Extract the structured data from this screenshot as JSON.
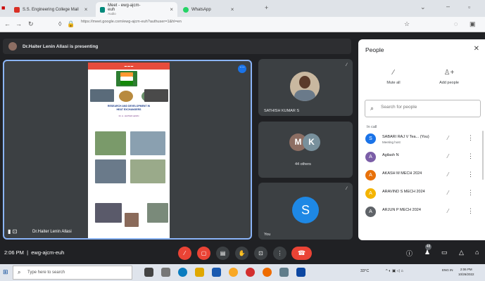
{
  "browser": {
    "tabs": [
      {
        "label": "S.S. Engineering College Mail",
        "icon": "gmail-icon",
        "color": "#d93025"
      },
      {
        "label": "Meet - ewg-ajcm-euh",
        "sublabel": "Audio",
        "icon": "meet-icon",
        "color": "#00897b"
      },
      {
        "label": "WhatsApp",
        "icon": "whatsapp-icon",
        "color": "#25d366"
      }
    ],
    "url": "https://meet.google.com/ewg-ajcm-euh?authuser=1&hl=en"
  },
  "meet": {
    "presenting_text": "Dr.Haiter Lenin Allasi is presenting",
    "main_tile": {
      "presenter_name": "Dr.Haiter Lenin Allasi",
      "slide": {
        "title_line1": "RESEARCH AND DEVELOPMENT IN",
        "title_line2": "HEAT EXCHANGERS",
        "author": "Dr. A. HAITER LENIN"
      }
    },
    "side_tiles": [
      {
        "name": "SATHISH KUMAR S"
      },
      {
        "name": "44 others",
        "initials": [
          "M",
          "K"
        ]
      },
      {
        "name": "You",
        "initial": "S"
      }
    ]
  },
  "people": {
    "title": "People",
    "mute_all": "Mute all",
    "add_people": "Add people",
    "search_placeholder": "Search for people",
    "in_call": "In call",
    "participants": [
      {
        "name": "SABARI RAJ V Tea...",
        "tag": "(You)",
        "sub": "Meeting host",
        "initial": "S",
        "color": "#1a73e8"
      },
      {
        "name": "Agilash N",
        "initial": "A",
        "color": "#7b5ea7"
      },
      {
        "name": "AKASH M MECH 2024",
        "initial": "A",
        "color": "#e8710a"
      },
      {
        "name": "ARAVIND S MECH 2024",
        "initial": "A",
        "color": "#f4b400"
      },
      {
        "name": "ARJUN P MECH 2024",
        "initial": "A",
        "color": "#5f6368"
      }
    ]
  },
  "controls": {
    "clock": "2:06 PM",
    "meeting_code": "ewg-ajcm-euh",
    "participant_count": "48"
  },
  "taskbar": {
    "search_placeholder": "Type here to search",
    "temperature": "33°C",
    "time": "2:06 PM",
    "date": "10/26/2022",
    "lang": "ENG IN"
  }
}
